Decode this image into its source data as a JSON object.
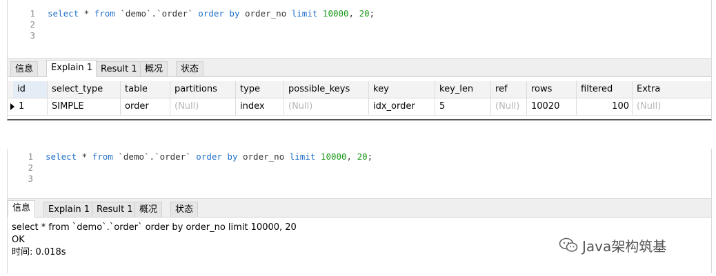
{
  "panels": [
    {
      "editor": {
        "line_numbers": [
          "1",
          "2",
          "3"
        ],
        "query": {
          "kw_select": "select",
          "star": " * ",
          "kw_from": "from",
          "table": " `demo`.`order` ",
          "kw_order_by": "order by",
          "column": " order_no ",
          "kw_limit": "limit",
          "num_offset": " 10000",
          "comma": ", ",
          "num_count": "20",
          "semi": ";"
        }
      },
      "tabs": [
        {
          "label": "信息",
          "active": false
        },
        {
          "label": "Explain 1",
          "active": true
        },
        {
          "label": "Result 1",
          "active": false
        },
        {
          "label": "概况",
          "active": false
        },
        {
          "label": "状态",
          "active": false
        }
      ],
      "explain": {
        "columns": [
          "id",
          "select_type",
          "table",
          "partitions",
          "type",
          "possible_keys",
          "key",
          "key_len",
          "ref",
          "rows",
          "filtered",
          "Extra"
        ],
        "row": [
          "1",
          "SIMPLE",
          "order",
          "(Null)",
          "index",
          "(Null)",
          "idx_order",
          "5",
          "(Null)",
          "10020",
          "100",
          "(Null)"
        ]
      }
    },
    {
      "editor": {
        "line_numbers": [
          "1",
          "2",
          "3"
        ],
        "query": {
          "kw_select": "select",
          "star": " * ",
          "kw_from": "from",
          "table": " `demo`.`order` ",
          "kw_order_by": "order by",
          "column": " order_no ",
          "kw_limit": "limit",
          "num_offset": " 10000",
          "comma": ", ",
          "num_count": "20",
          "semi": ";"
        }
      },
      "tabs": [
        {
          "label": "信息",
          "active": true
        },
        {
          "label": "Explain 1",
          "active": false
        },
        {
          "label": "Result 1",
          "active": false
        },
        {
          "label": "概况",
          "active": false
        },
        {
          "label": "状态",
          "active": false
        }
      ],
      "info": {
        "sql": "select * from `demo`.`order` order by order_no limit 10000, 20",
        "status": "OK",
        "time": "时间: 0.018s"
      }
    }
  ],
  "watermark": {
    "text": "Java架构筑基",
    "icon": "wechat-icon"
  },
  "colors": {
    "keyword": "#1e6ec8",
    "number": "#1a9a1a",
    "null_text": "#b5b5b5"
  }
}
